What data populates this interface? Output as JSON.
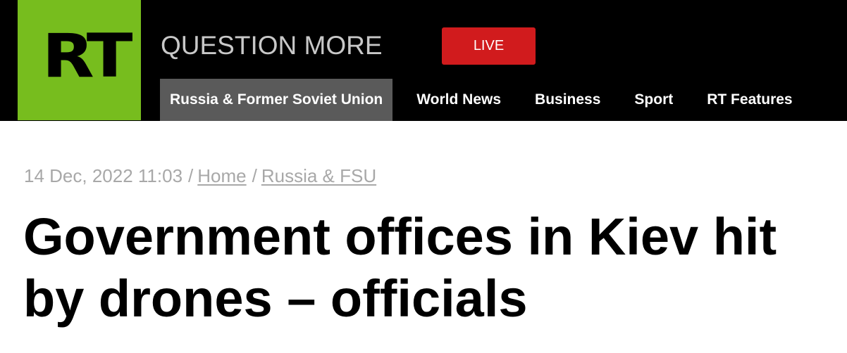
{
  "header": {
    "logo_text": "RT",
    "tagline": "QUESTION MORE",
    "live_label": "LIVE",
    "colors": {
      "logo_green": "#77bd1e",
      "live_red": "#d11b1d",
      "active_tab": "#5a5a5a",
      "bar": "#000000"
    }
  },
  "nav": {
    "items": [
      {
        "label": "Russia & Former Soviet Union",
        "active": true
      },
      {
        "label": "World News",
        "active": false
      },
      {
        "label": "Business",
        "active": false
      },
      {
        "label": "Sport",
        "active": false
      },
      {
        "label": "RT Features",
        "active": false
      }
    ]
  },
  "article": {
    "timestamp": "14 Dec, 2022 11:03",
    "separator": "/",
    "breadcrumbs": [
      "Home",
      "Russia & FSU"
    ],
    "headline": "Government offices in Kiev hit by drones – officials"
  }
}
